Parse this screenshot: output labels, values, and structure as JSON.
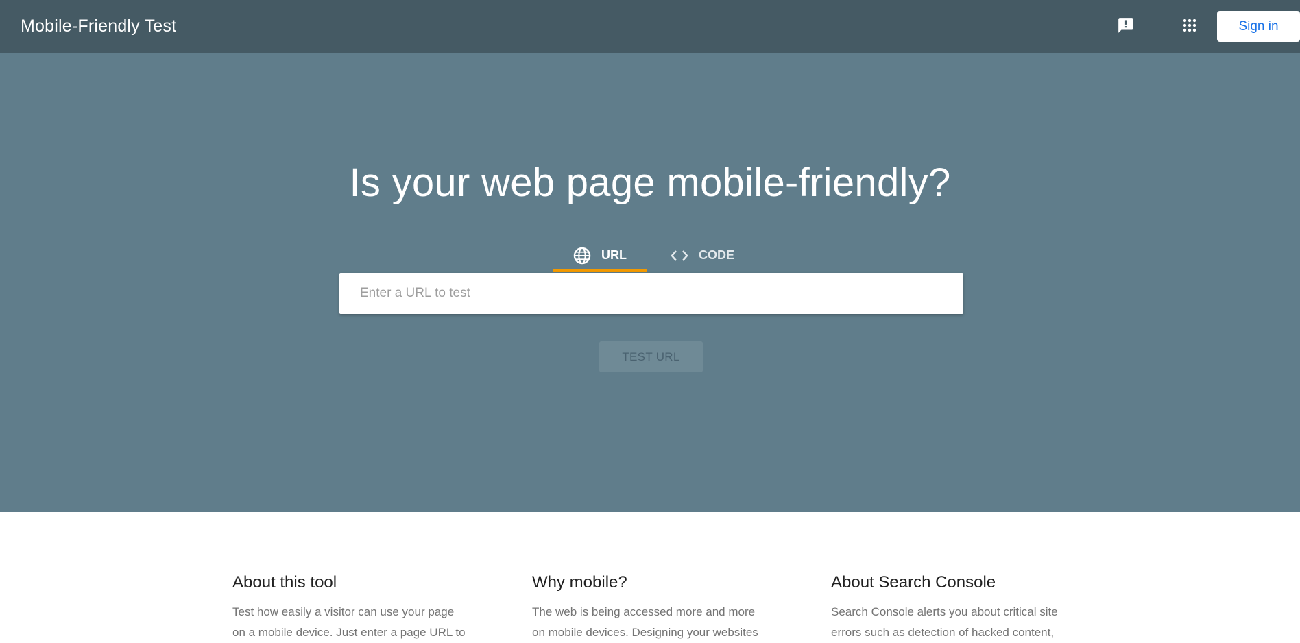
{
  "header": {
    "title": "Mobile-Friendly Test",
    "feedback_icon": "feedback-icon",
    "apps_icon": "apps-grid-icon",
    "signin_label": "Sign in"
  },
  "hero": {
    "title": "Is your web page mobile-friendly?",
    "tabs": [
      {
        "label": "URL",
        "icon": "globe-icon",
        "selected": true
      },
      {
        "label": "CODE",
        "icon": "code-icon",
        "selected": false
      }
    ],
    "url_input": {
      "value": "",
      "placeholder": "Enter a URL to test"
    },
    "test_button_label": "TEST URL"
  },
  "info": [
    {
      "heading": "About this tool",
      "lines": [
        "Test how easily a visitor can use your page",
        "on a mobile device. Just enter a page URL to"
      ]
    },
    {
      "heading": "Why mobile?",
      "lines": [
        "The web is being accessed more and more",
        "on mobile devices. Designing your websites"
      ]
    },
    {
      "heading": "About Search Console",
      "lines": [
        "Search Console alerts you about critical site",
        "errors such as detection of hacked content,"
      ]
    }
  ],
  "colors": {
    "topbar": "#455a64",
    "hero": "#607d8b",
    "tab_indicator": "#f29900",
    "signin_text": "#1a73e8"
  }
}
